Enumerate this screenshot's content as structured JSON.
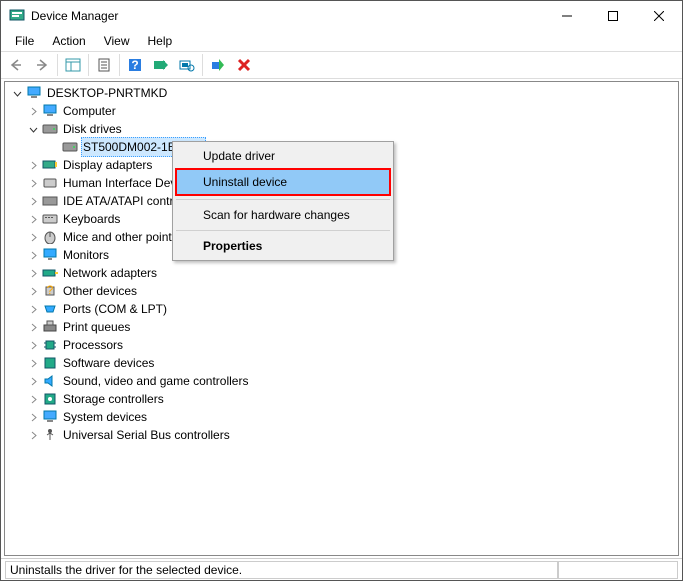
{
  "window": {
    "title": "Device Manager"
  },
  "menu": {
    "file": "File",
    "action": "Action",
    "view": "View",
    "help": "Help"
  },
  "tree": {
    "root": "DESKTOP-PNRTMKD",
    "computer": "Computer",
    "diskdrives": "Disk drives",
    "hdd": "ST500DM002-1BD142",
    "display": "Display adapters",
    "hid": "Human Interface Devices",
    "ide": "IDE ATA/ATAPI controllers",
    "keyboards": "Keyboards",
    "mice": "Mice and other pointing devices",
    "monitors": "Monitors",
    "network": "Network adapters",
    "other": "Other devices",
    "ports": "Ports (COM & LPT)",
    "printq": "Print queues",
    "processors": "Processors",
    "softdev": "Software devices",
    "sound": "Sound, video and game controllers",
    "storage": "Storage controllers",
    "system": "System devices",
    "usb": "Universal Serial Bus controllers"
  },
  "context_menu": {
    "update": "Update driver",
    "uninstall": "Uninstall device",
    "scan": "Scan for hardware changes",
    "properties": "Properties"
  },
  "statusbar": {
    "text": "Uninstalls the driver for the selected device."
  }
}
